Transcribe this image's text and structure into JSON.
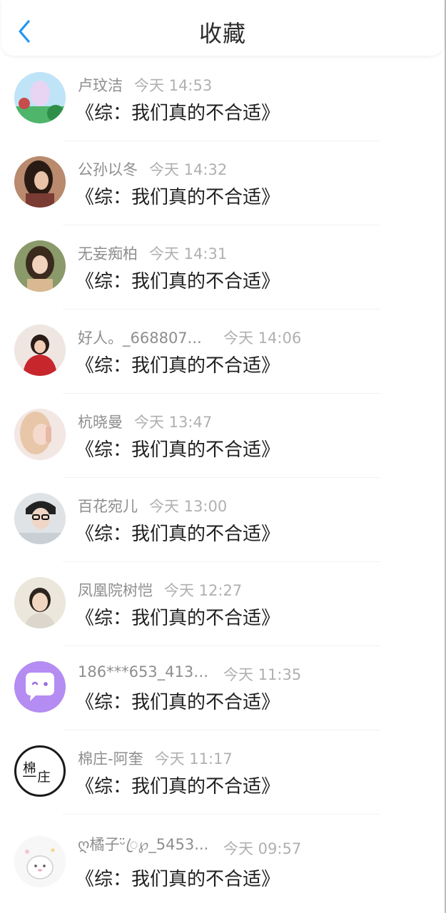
{
  "header": {
    "title": "收藏"
  },
  "items": [
    {
      "name": "卢玟洁",
      "time": "今天 14:53",
      "title": "《综：我们真的不合适》"
    },
    {
      "name": "公孙以冬",
      "time": "今天 14:32",
      "title": "《综：我们真的不合适》"
    },
    {
      "name": "无妄痴柏",
      "time": "今天 14:31",
      "title": "《综：我们真的不合适》"
    },
    {
      "name": "好人。_668807...",
      "time": "今天 14:06",
      "title": "《综：我们真的不合适》"
    },
    {
      "name": "杭晓曼",
      "time": "今天 13:47",
      "title": "《综：我们真的不合适》"
    },
    {
      "name": "百花宛儿",
      "time": "今天 13:00",
      "title": "《综：我们真的不合适》"
    },
    {
      "name": "凤凰院树恺",
      "time": "今天 12:27",
      "title": "《综：我们真的不合适》"
    },
    {
      "name": "186***653_4133...",
      "time": "今天 11:35",
      "title": "《综：我们真的不合适》"
    },
    {
      "name": "棉庄-阿奎",
      "time": "今天 11:17",
      "title": "《综：我们真的不合适》",
      "avatar_text": "棉庄"
    },
    {
      "name": "ღ橘子ᵕ̈ꦿ℘_5453...",
      "time": "今天 09:57",
      "title": "《综：我们真的不合适》"
    }
  ],
  "colors": {
    "accent": "#2196f3",
    "name": "#8e8e8e",
    "time": "#b0b0b0",
    "title": "#1f1f1f"
  },
  "icons": {
    "back": "chevron-left-icon"
  }
}
